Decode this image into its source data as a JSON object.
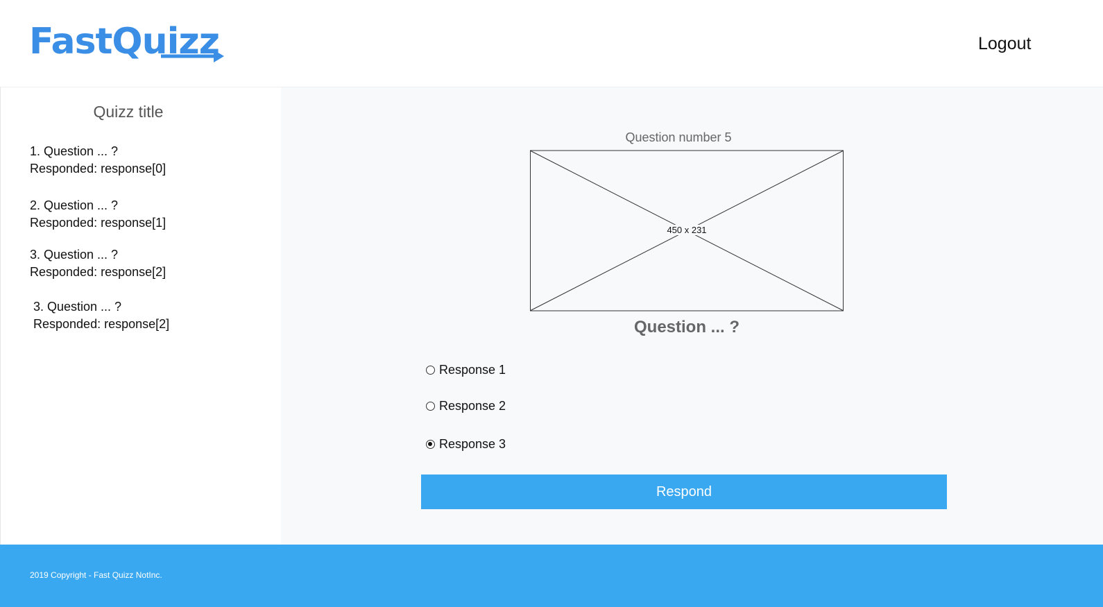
{
  "header": {
    "logo_text": "FastQuizz",
    "logout_label": "Logout",
    "brand_color": "#3a8ee6"
  },
  "sidebar": {
    "title": "Quizz title",
    "items": [
      {
        "question": "1. Question ... ?",
        "response": "Responded: response[0]"
      },
      {
        "question": "2. Question ... ?",
        "response": "Responded: response[1]"
      },
      {
        "question": "3. Question ... ?",
        "response": "Responded: response[2]"
      },
      {
        "question": "3. Question ... ?",
        "response": "Responded: response[2]"
      }
    ]
  },
  "main": {
    "question_number": "Question number 5",
    "image_placeholder_label": "450 x 231",
    "question_text": "Question ... ?",
    "options": [
      {
        "label": "Response 1",
        "checked": false
      },
      {
        "label": "Response 2",
        "checked": false
      },
      {
        "label": "Response 3",
        "checked": true
      }
    ],
    "respond_button_label": "Respond",
    "accent_color": "#3aa8f0"
  },
  "footer": {
    "copyright": "2019 Copyright - Fast Quizz NotInc."
  }
}
